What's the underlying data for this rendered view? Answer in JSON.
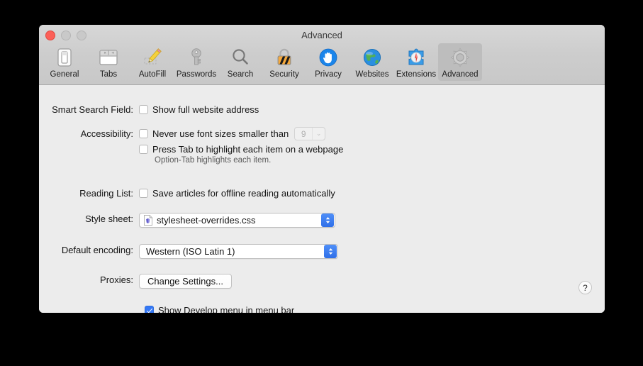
{
  "window": {
    "title": "Advanced",
    "traffic_lights": [
      "close-button",
      "minimize-button",
      "zoom-button"
    ]
  },
  "toolbar": {
    "items": [
      {
        "label": "General",
        "icon": "general-icon",
        "selected": false
      },
      {
        "label": "Tabs",
        "icon": "tabs-icon",
        "selected": false
      },
      {
        "label": "AutoFill",
        "icon": "autofill-icon",
        "selected": false
      },
      {
        "label": "Passwords",
        "icon": "passwords-icon",
        "selected": false
      },
      {
        "label": "Search",
        "icon": "search-icon",
        "selected": false
      },
      {
        "label": "Security",
        "icon": "security-icon",
        "selected": false
      },
      {
        "label": "Privacy",
        "icon": "privacy-icon",
        "selected": false
      },
      {
        "label": "Websites",
        "icon": "websites-icon",
        "selected": false
      },
      {
        "label": "Extensions",
        "icon": "extensions-icon",
        "selected": false
      },
      {
        "label": "Advanced",
        "icon": "advanced-icon",
        "selected": true
      }
    ]
  },
  "form": {
    "smart_search": {
      "label": "Smart Search Field:",
      "checkbox_label": "Show full website address",
      "checked": false
    },
    "accessibility": {
      "label": "Accessibility:",
      "font_size_label": "Never use font sizes smaller than",
      "font_size_checked": false,
      "font_size_value": "9",
      "font_size_enabled": false,
      "tab_highlight_label": "Press Tab to highlight each item on a webpage",
      "tab_highlight_checked": false,
      "hint": "Option-Tab highlights each item."
    },
    "reading_list": {
      "label": "Reading List:",
      "checkbox_label": "Save articles for offline reading automatically",
      "checked": false
    },
    "style_sheet": {
      "label": "Style sheet:",
      "value": "stylesheet-overrides.css",
      "icon": "css-file-icon"
    },
    "default_encoding": {
      "label": "Default encoding:",
      "value": "Western (ISO Latin 1)"
    },
    "proxies": {
      "label": "Proxies:",
      "button_label": "Change Settings..."
    },
    "develop_menu": {
      "checkbox_label": "Show Develop menu in menu bar",
      "checked": true
    },
    "help_button_label": "?"
  },
  "colors": {
    "accent_blue": "#3478f6",
    "window_bg": "#ececec",
    "toolbar_bg": "#cdcdcd",
    "selected_tab_bg": "#bdbdbd",
    "close_red": "#fc6058"
  }
}
